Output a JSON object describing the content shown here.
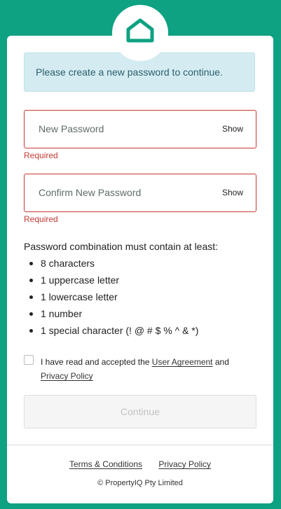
{
  "brand": {
    "logo": "house-icon",
    "accent_color": "#0ea182",
    "error_color": "#c33a33"
  },
  "info": {
    "message": "Please create a new password to continue."
  },
  "new_password": {
    "placeholder": "New Password",
    "toggle_label": "Show",
    "error": "Required"
  },
  "confirm_password": {
    "placeholder": "Confirm New Password",
    "toggle_label": "Show",
    "error": "Required"
  },
  "requirements": {
    "title": "Password combination must contain at least:",
    "items": [
      "8 characters",
      "1 uppercase letter",
      "1 lowercase letter",
      "1 number",
      "1 special character (! @ # $ % ^ & *)"
    ]
  },
  "agreement": {
    "prefix": "I have read and accepted the",
    "user_agreement": "User Agreement",
    "middle": "and",
    "privacy_policy": "Privacy Policy",
    "checked": false
  },
  "continue_label": "Continue",
  "footer": {
    "terms": "Terms & Conditions",
    "privacy": "Privacy Policy",
    "copyright": "© PropertyIQ Pty Limited"
  }
}
